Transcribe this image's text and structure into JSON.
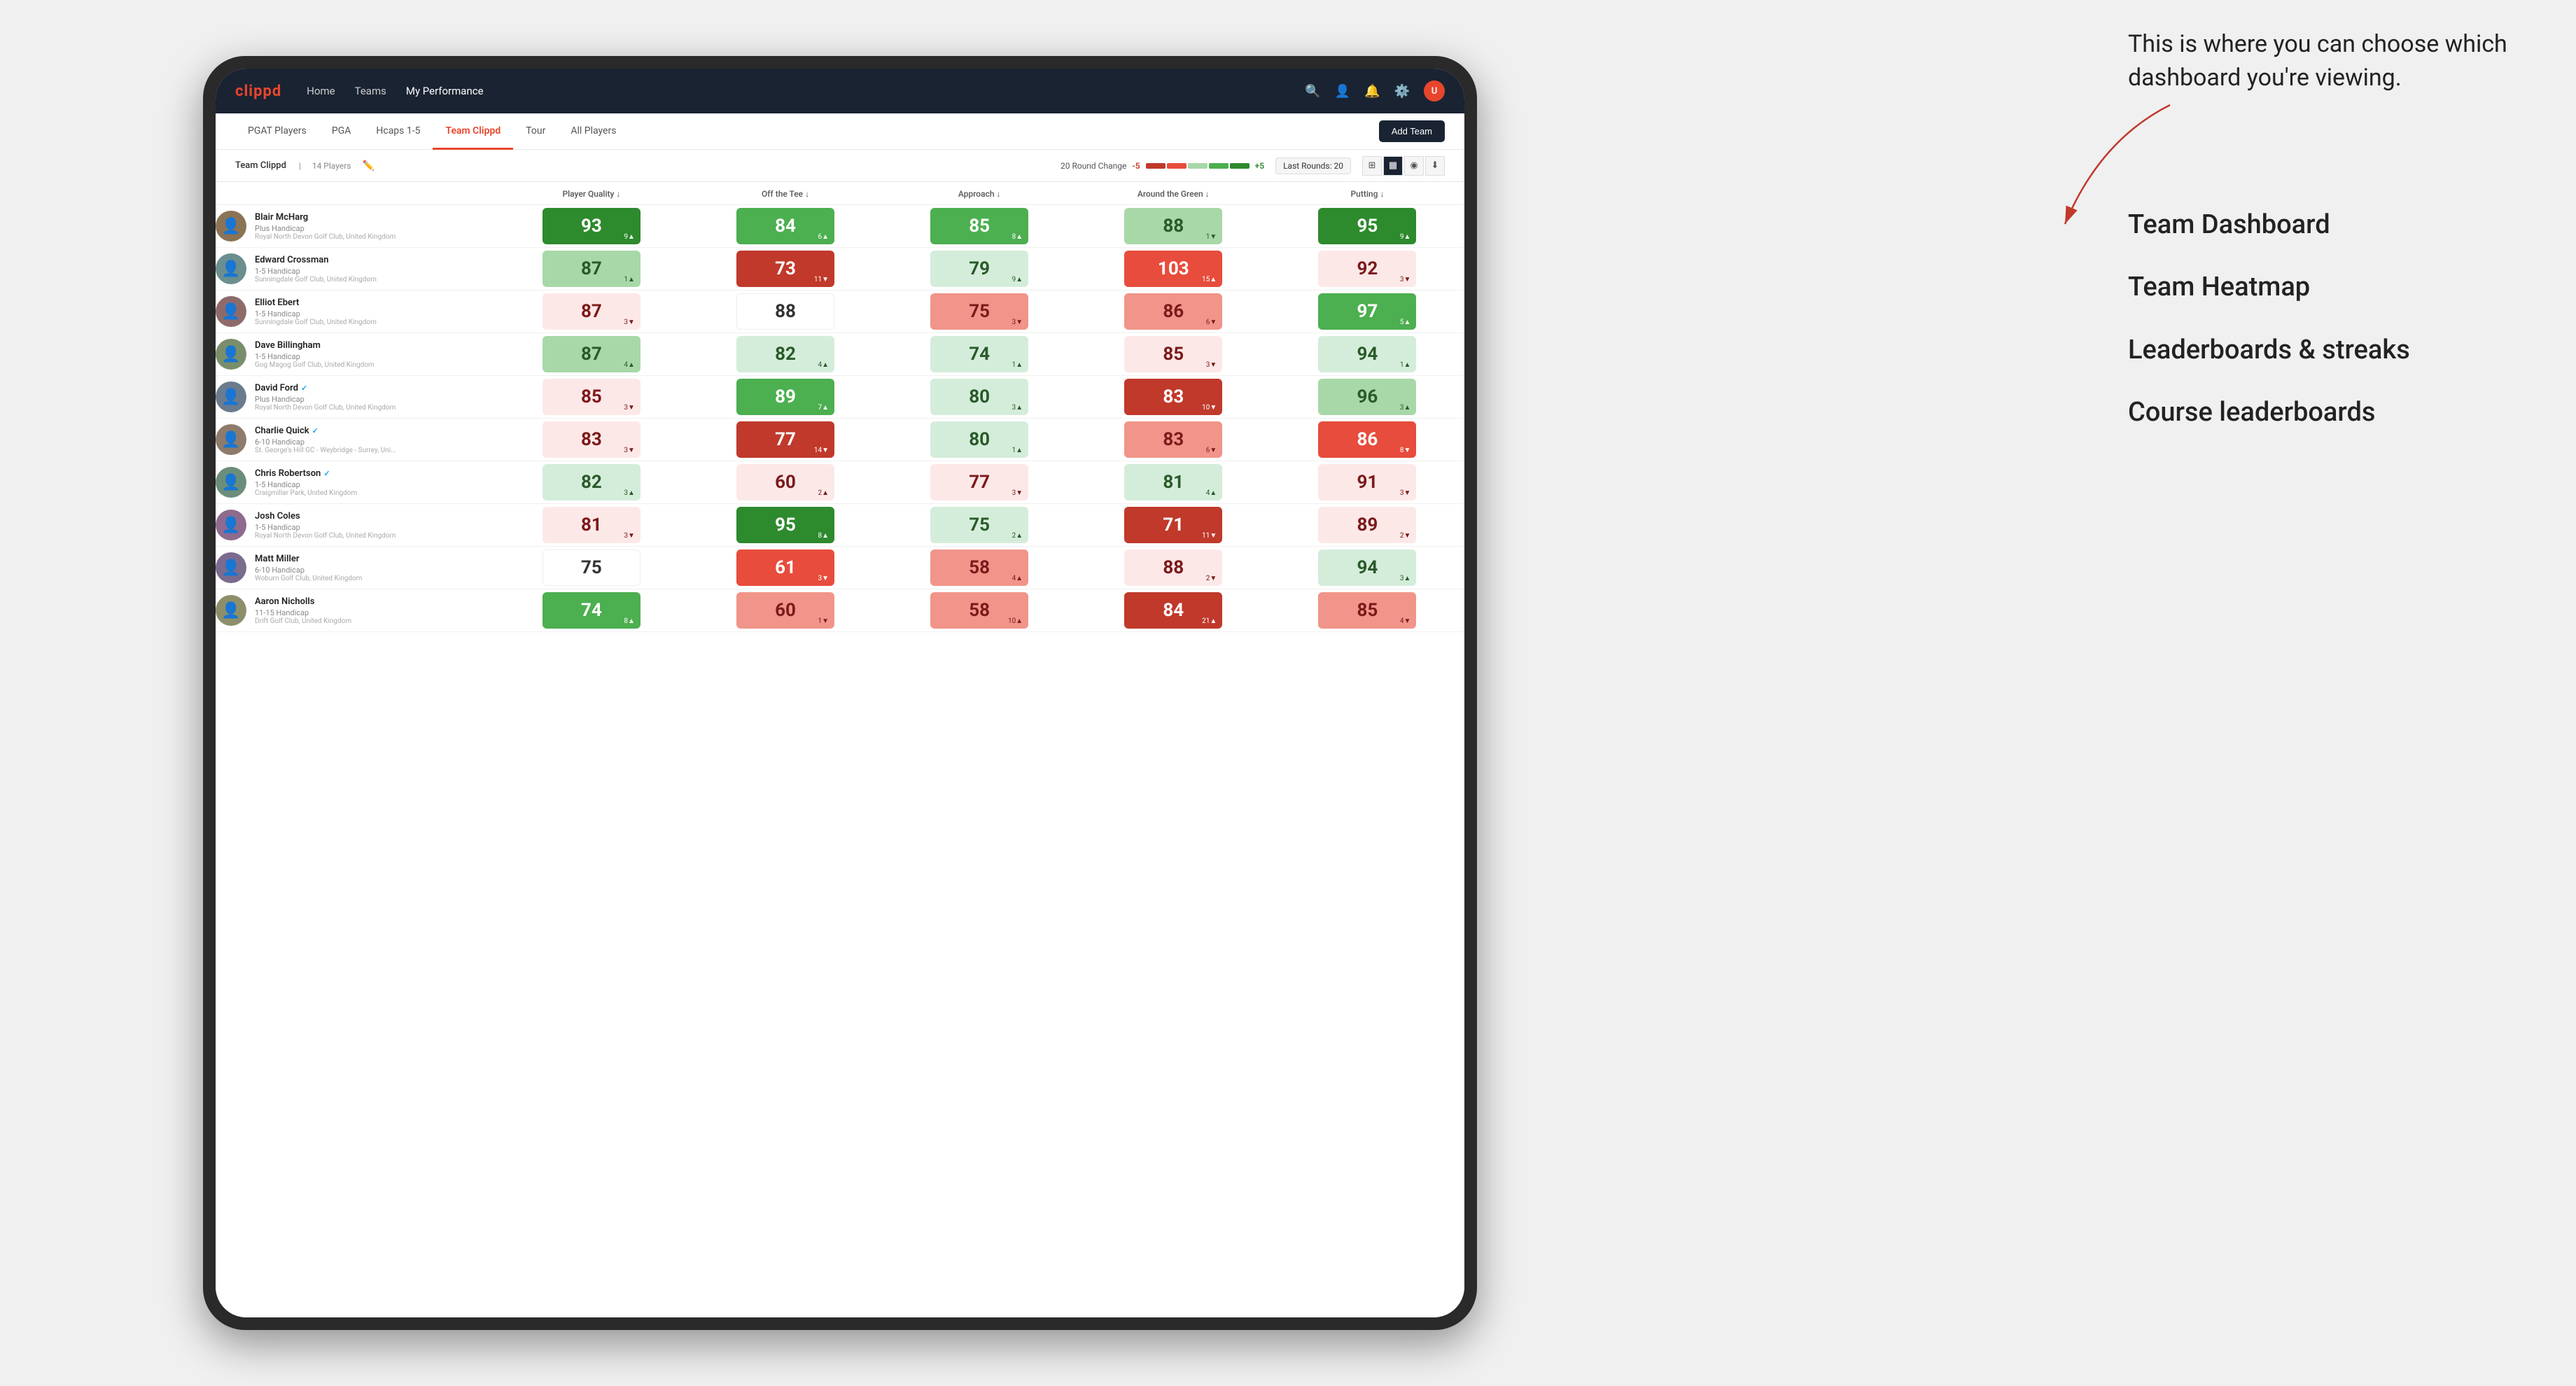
{
  "annotation": {
    "intro_text": "This is where you can choose which dashboard you're viewing.",
    "options": [
      "Team Dashboard",
      "Team Heatmap",
      "Leaderboards & streaks",
      "Course leaderboards"
    ]
  },
  "navbar": {
    "logo": "clippd",
    "links": [
      "Home",
      "Teams",
      "My Performance"
    ],
    "active_link": "My Performance"
  },
  "tabs": {
    "items": [
      "PGAT Players",
      "PGA",
      "Hcaps 1-5",
      "Team Clippd",
      "Tour",
      "All Players"
    ],
    "active": "Team Clippd"
  },
  "add_team_btn": "Add Team",
  "toolbar": {
    "team_name": "Team Clippd",
    "player_count": "14 Players",
    "round_change_label": "20 Round Change",
    "round_change_neg": "-5",
    "round_change_pos": "+5",
    "last_rounds_label": "Last Rounds:",
    "last_rounds_value": "20"
  },
  "table": {
    "columns": [
      "Player Quality ↓",
      "Off the Tee ↓",
      "Approach ↓",
      "Around the Green ↓",
      "Putting ↓"
    ],
    "players": [
      {
        "name": "Blair McHarg",
        "handicap": "Plus Handicap",
        "club": "Royal North Devon Golf Club, United Kingdom",
        "verified": false,
        "metrics": [
          {
            "value": "93",
            "change": "9▲",
            "color": "green-dark"
          },
          {
            "value": "84",
            "change": "6▲",
            "color": "green-med"
          },
          {
            "value": "85",
            "change": "8▲",
            "color": "green-med"
          },
          {
            "value": "88",
            "change": "1▼",
            "color": "green-light"
          },
          {
            "value": "95",
            "change": "9▲",
            "color": "green-dark"
          }
        ]
      },
      {
        "name": "Edward Crossman",
        "handicap": "1-5 Handicap",
        "club": "Sunningdale Golf Club, United Kingdom",
        "verified": false,
        "metrics": [
          {
            "value": "87",
            "change": "1▲",
            "color": "green-light"
          },
          {
            "value": "73",
            "change": "11▼",
            "color": "red-dark"
          },
          {
            "value": "79",
            "change": "9▲",
            "color": "green-pale"
          },
          {
            "value": "103",
            "change": "15▲",
            "color": "red-med"
          },
          {
            "value": "92",
            "change": "3▼",
            "color": "red-pale"
          }
        ]
      },
      {
        "name": "Elliot Ebert",
        "handicap": "1-5 Handicap",
        "club": "Sunningdale Golf Club, United Kingdom",
        "verified": false,
        "metrics": [
          {
            "value": "87",
            "change": "3▼",
            "color": "red-pale"
          },
          {
            "value": "88",
            "change": "",
            "color": "neutral"
          },
          {
            "value": "75",
            "change": "3▼",
            "color": "red-light"
          },
          {
            "value": "86",
            "change": "6▼",
            "color": "red-light"
          },
          {
            "value": "97",
            "change": "5▲",
            "color": "green-med"
          }
        ]
      },
      {
        "name": "Dave Billingham",
        "handicap": "1-5 Handicap",
        "club": "Gog Magog Golf Club, United Kingdom",
        "verified": false,
        "metrics": [
          {
            "value": "87",
            "change": "4▲",
            "color": "green-light"
          },
          {
            "value": "82",
            "change": "4▲",
            "color": "green-pale"
          },
          {
            "value": "74",
            "change": "1▲",
            "color": "green-pale"
          },
          {
            "value": "85",
            "change": "3▼",
            "color": "red-pale"
          },
          {
            "value": "94",
            "change": "1▲",
            "color": "green-pale"
          }
        ]
      },
      {
        "name": "David Ford",
        "handicap": "Plus Handicap",
        "club": "Royal North Devon Golf Club, United Kingdom",
        "verified": true,
        "metrics": [
          {
            "value": "85",
            "change": "3▼",
            "color": "red-pale"
          },
          {
            "value": "89",
            "change": "7▲",
            "color": "green-med"
          },
          {
            "value": "80",
            "change": "3▲",
            "color": "green-pale"
          },
          {
            "value": "83",
            "change": "10▼",
            "color": "red-dark"
          },
          {
            "value": "96",
            "change": "3▲",
            "color": "green-light"
          }
        ]
      },
      {
        "name": "Charlie Quick",
        "handicap": "6-10 Handicap",
        "club": "St. George's Hill GC - Weybridge - Surrey, Uni...",
        "verified": true,
        "metrics": [
          {
            "value": "83",
            "change": "3▼",
            "color": "red-pale"
          },
          {
            "value": "77",
            "change": "14▼",
            "color": "red-dark"
          },
          {
            "value": "80",
            "change": "1▲",
            "color": "green-pale"
          },
          {
            "value": "83",
            "change": "6▼",
            "color": "red-light"
          },
          {
            "value": "86",
            "change": "8▼",
            "color": "red-med"
          }
        ]
      },
      {
        "name": "Chris Robertson",
        "handicap": "1-5 Handicap",
        "club": "Craigmillar Park, United Kingdom",
        "verified": true,
        "metrics": [
          {
            "value": "82",
            "change": "3▲",
            "color": "green-pale"
          },
          {
            "value": "60",
            "change": "2▲",
            "color": "red-pale"
          },
          {
            "value": "77",
            "change": "3▼",
            "color": "red-pale"
          },
          {
            "value": "81",
            "change": "4▲",
            "color": "green-pale"
          },
          {
            "value": "91",
            "change": "3▼",
            "color": "red-pale"
          }
        ]
      },
      {
        "name": "Josh Coles",
        "handicap": "1-5 Handicap",
        "club": "Royal North Devon Golf Club, United Kingdom",
        "verified": false,
        "metrics": [
          {
            "value": "81",
            "change": "3▼",
            "color": "red-pale"
          },
          {
            "value": "95",
            "change": "8▲",
            "color": "green-dark"
          },
          {
            "value": "75",
            "change": "2▲",
            "color": "green-pale"
          },
          {
            "value": "71",
            "change": "11▼",
            "color": "red-dark"
          },
          {
            "value": "89",
            "change": "2▼",
            "color": "red-pale"
          }
        ]
      },
      {
        "name": "Matt Miller",
        "handicap": "6-10 Handicap",
        "club": "Woburn Golf Club, United Kingdom",
        "verified": false,
        "metrics": [
          {
            "value": "75",
            "change": "",
            "color": "neutral"
          },
          {
            "value": "61",
            "change": "3▼",
            "color": "red-med"
          },
          {
            "value": "58",
            "change": "4▲",
            "color": "red-light"
          },
          {
            "value": "88",
            "change": "2▼",
            "color": "red-pale"
          },
          {
            "value": "94",
            "change": "3▲",
            "color": "green-pale"
          }
        ]
      },
      {
        "name": "Aaron Nicholls",
        "handicap": "11-15 Handicap",
        "club": "Drift Golf Club, United Kingdom",
        "verified": false,
        "metrics": [
          {
            "value": "74",
            "change": "8▲",
            "color": "green-med"
          },
          {
            "value": "60",
            "change": "1▼",
            "color": "red-light"
          },
          {
            "value": "58",
            "change": "10▲",
            "color": "red-light"
          },
          {
            "value": "84",
            "change": "21▲",
            "color": "red-dark"
          },
          {
            "value": "85",
            "change": "4▼",
            "color": "red-light"
          }
        ]
      }
    ]
  }
}
